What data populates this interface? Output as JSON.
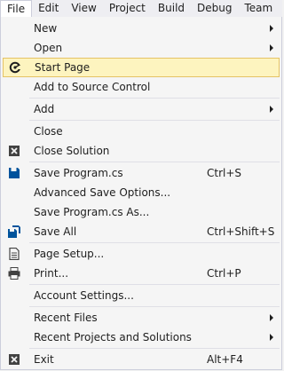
{
  "menubar": {
    "items": [
      "File",
      "Edit",
      "View",
      "Project",
      "Build",
      "Debug",
      "Team"
    ]
  },
  "file_menu": {
    "new": {
      "label": "New"
    },
    "open": {
      "label": "Open"
    },
    "start_page": {
      "label": "Start Page",
      "icon": "start-page-icon"
    },
    "add_to_source_control": {
      "label": "Add to Source Control"
    },
    "add": {
      "label": "Add"
    },
    "close": {
      "label": "Close"
    },
    "close_solution": {
      "label": "Close Solution",
      "icon": "close-solution-icon"
    },
    "save_program": {
      "label": "Save Program.cs",
      "shortcut": "Ctrl+S",
      "icon": "save-icon"
    },
    "advanced_save_options": {
      "label": "Advanced Save Options..."
    },
    "save_program_as": {
      "label": "Save Program.cs As..."
    },
    "save_all": {
      "label": "Save All",
      "shortcut": "Ctrl+Shift+S",
      "icon": "save-all-icon"
    },
    "page_setup": {
      "label": "Page Setup...",
      "icon": "page-setup-icon"
    },
    "print": {
      "label": "Print...",
      "shortcut": "Ctrl+P",
      "icon": "print-icon"
    },
    "account_settings": {
      "label": "Account Settings..."
    },
    "recent_files": {
      "label": "Recent Files"
    },
    "recent_projects": {
      "label": "Recent Projects and Solutions"
    },
    "exit": {
      "label": "Exit",
      "shortcut": "Alt+F4",
      "icon": "exit-icon"
    }
  },
  "colors": {
    "highlight_bg": "#fdf4bf",
    "highlight_border": "#e5c365",
    "menu_bg": "#f5f5f5",
    "icon_color": "#1e1e1e"
  }
}
